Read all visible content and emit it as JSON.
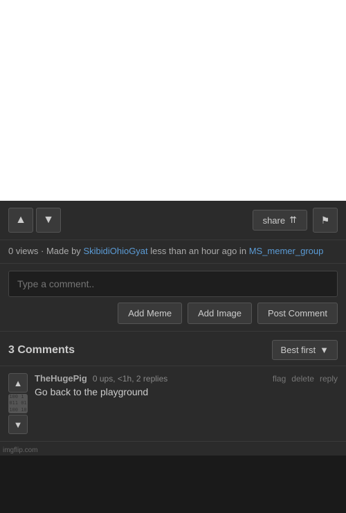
{
  "image_area": {
    "background": "white"
  },
  "post_actions": {
    "upvote_label": "▲",
    "downvote_label": "▼",
    "share_label": "share",
    "flag_label": "⚑"
  },
  "post_meta": {
    "views": "0 views",
    "made_by_label": "Made by",
    "username": "SkibidiOhioGyat",
    "time": "less than an hour ago in",
    "group": "MS_memer_group"
  },
  "comment_input": {
    "placeholder": "Type a comment..",
    "add_meme_label": "Add Meme",
    "add_image_label": "Add Image",
    "post_comment_label": "Post Comment"
  },
  "comments_section": {
    "title": "3 Comments",
    "sort_label": "Best first",
    "sort_arrow": "▼"
  },
  "comment": {
    "username": "TheHugePig",
    "stats": "0 ups, <1h, 2 replies",
    "flag_label": "flag",
    "delete_label": "delete",
    "reply_label": "reply",
    "text": "Go back to the playground",
    "avatar_lines": [
      "100 1",
      "011 01",
      "100 10"
    ]
  },
  "footer": {
    "imgflip": "imgflip.com"
  }
}
